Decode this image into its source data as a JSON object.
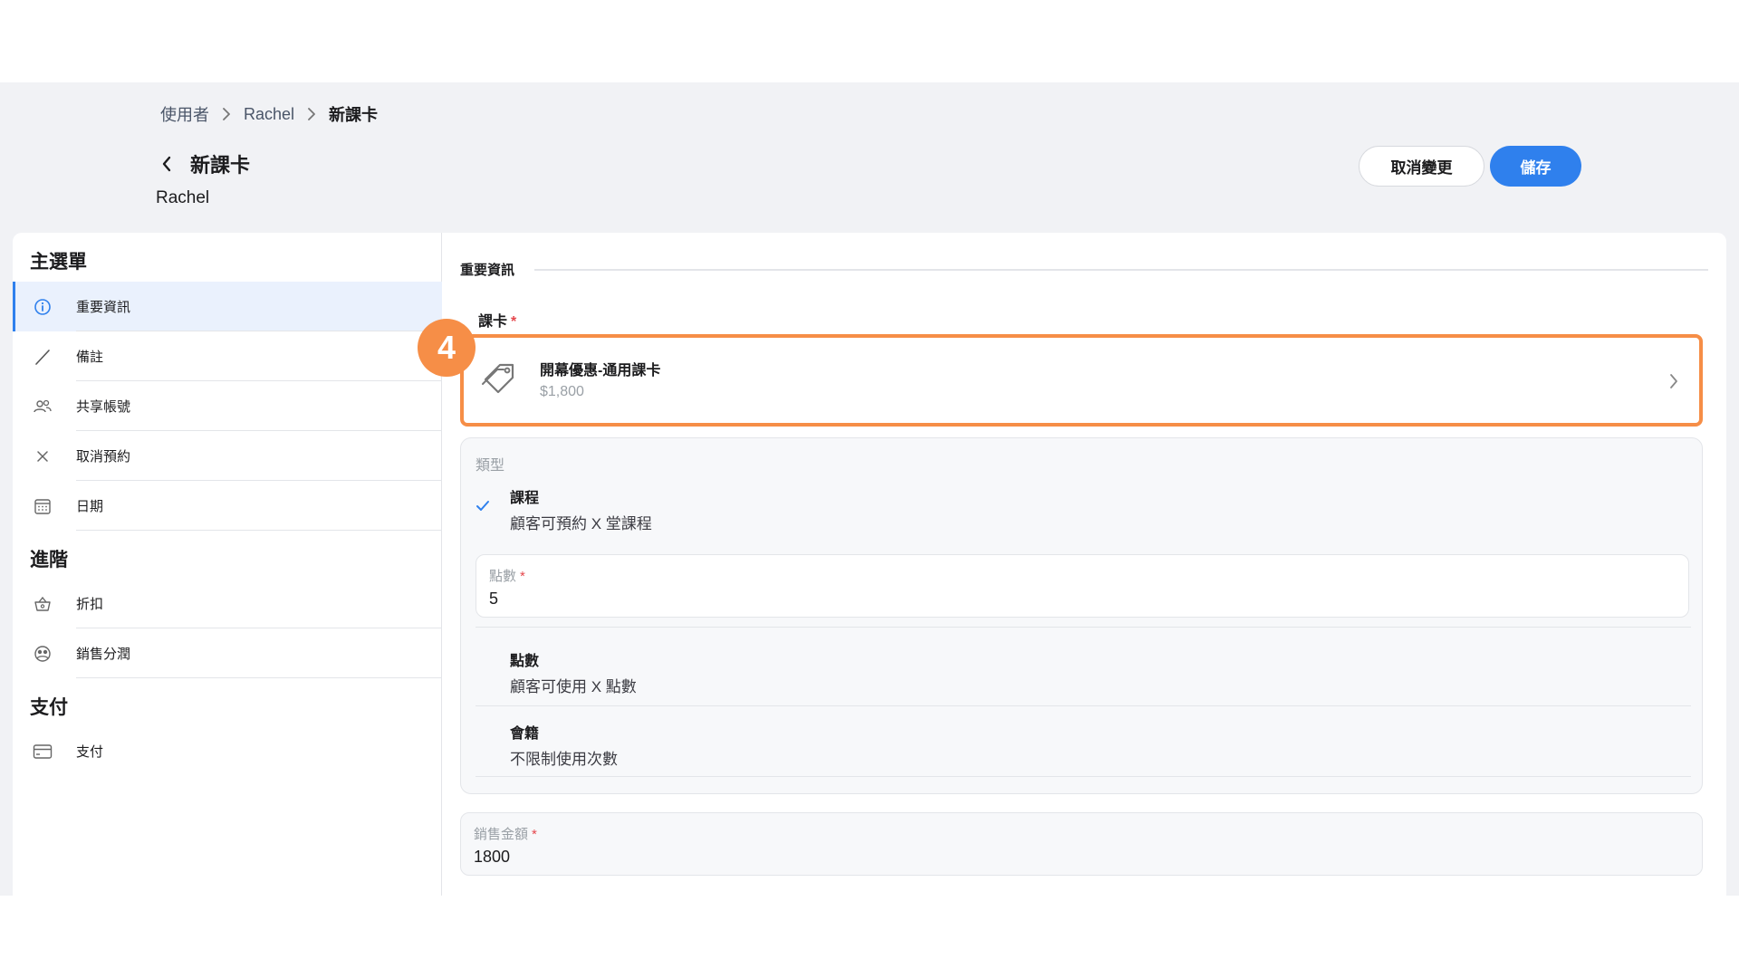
{
  "breadcrumb": {
    "items": [
      "使用者",
      "Rachel",
      "新課卡"
    ]
  },
  "header": {
    "title": "新課卡",
    "subtitle": "Rachel",
    "cancel_label": "取消變更",
    "save_label": "儲存"
  },
  "sidebar": {
    "main_title": "主選單",
    "main_items": [
      {
        "label": "重要資訊",
        "icon": "info-icon",
        "active": true
      },
      {
        "label": "備註",
        "icon": "pencil-icon"
      },
      {
        "label": "共享帳號",
        "icon": "users-icon"
      },
      {
        "label": "取消預約",
        "icon": "close-icon"
      },
      {
        "label": "日期",
        "icon": "calendar-icon"
      }
    ],
    "advanced_title": "進階",
    "advanced_items": [
      {
        "label": "折扣",
        "icon": "basket-icon"
      },
      {
        "label": "銷售分潤",
        "icon": "commission-icon"
      }
    ],
    "payment_title": "支付",
    "payment_items": [
      {
        "label": "支付",
        "icon": "credit-card-icon"
      }
    ]
  },
  "main": {
    "section_title": "重要資訊",
    "course_field_label": "課卡",
    "required_mark": "*",
    "course": {
      "name": "開幕優惠-通用課卡",
      "price": "$1,800"
    },
    "step_badge": "4",
    "type_label": "類型",
    "options": [
      {
        "title": "課程",
        "desc": "顧客可預約 X 堂課程",
        "selected": true
      },
      {
        "title": "點數",
        "desc": "顧客可使用 X 點數"
      },
      {
        "title": "會籍",
        "desc": "不限制使用次數"
      }
    ],
    "points_field": {
      "label": "點數",
      "value": "5"
    },
    "amount_field": {
      "label": "銷售金額",
      "value": "1800"
    }
  },
  "colors": {
    "accent": "#2f80ed",
    "highlight": "#f68e47",
    "required": "#e5484d"
  }
}
